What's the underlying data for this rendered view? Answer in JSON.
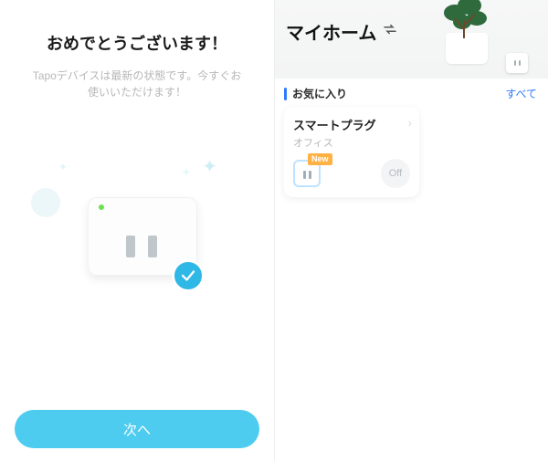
{
  "setup": {
    "title": "おめでとうございます！",
    "body": "Tapoデバイスは最新の状態です。今すぐお使いいただけます！",
    "next_label": "次へ"
  },
  "home": {
    "title": "マイホーム",
    "favorites_label": "お気に入り",
    "see_all_label": "すべて"
  },
  "device": {
    "name": "スマートプラグ",
    "location": "オフィス",
    "new_badge": "New",
    "power_label": "Off"
  },
  "icons": {
    "check": "check-icon",
    "swap": "swap-icon",
    "plug": "plug-icon"
  }
}
